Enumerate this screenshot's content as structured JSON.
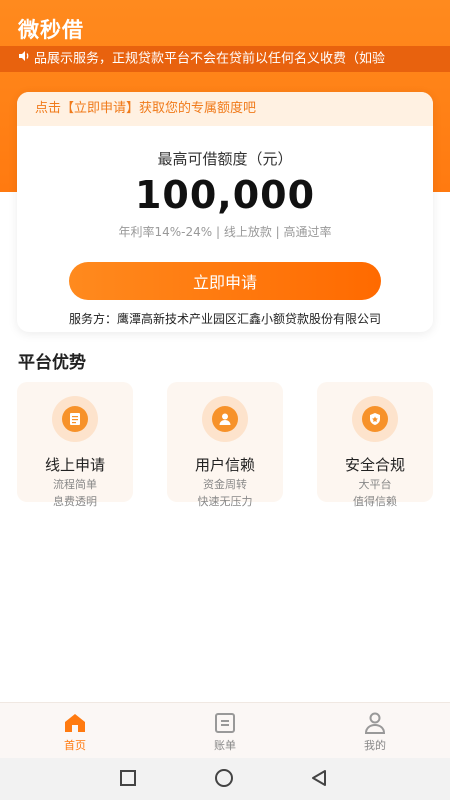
{
  "app": {
    "title": "微秒借"
  },
  "notice": {
    "text": "品展示服务，正规贷款平台不会在贷前以任何名义收费（如验"
  },
  "card": {
    "tip": "点击【立即申请】获取您的专属额度吧",
    "label": "最高可借额度（元）",
    "amount": "100,000",
    "meta": "年利率14%-24% | 线上放款 | 高通过率",
    "apply_button": "立即申请",
    "provider": "服务方：鹰潭高新技术产业园区汇鑫小额贷款股份有限公司"
  },
  "section": {
    "title": "平台优势"
  },
  "features": [
    {
      "icon": "document-icon",
      "title": "线上申请",
      "line1": "流程简单",
      "line2": "息费透明"
    },
    {
      "icon": "user-icon",
      "title": "用户信赖",
      "line1": "资金周转",
      "line2": "快速无压力"
    },
    {
      "icon": "shield-icon",
      "title": "安全合规",
      "line1": "大平台",
      "line2": "值得信赖"
    }
  ],
  "tabs": [
    {
      "icon": "home-icon",
      "label": "首页",
      "active": true
    },
    {
      "icon": "bill-icon",
      "label": "账单",
      "active": false
    },
    {
      "icon": "profile-icon",
      "label": "我的",
      "active": false
    }
  ],
  "colors": {
    "brand": "#ff7a10",
    "notice_bg": "#e8620e",
    "tip_text": "#f07a1a"
  }
}
